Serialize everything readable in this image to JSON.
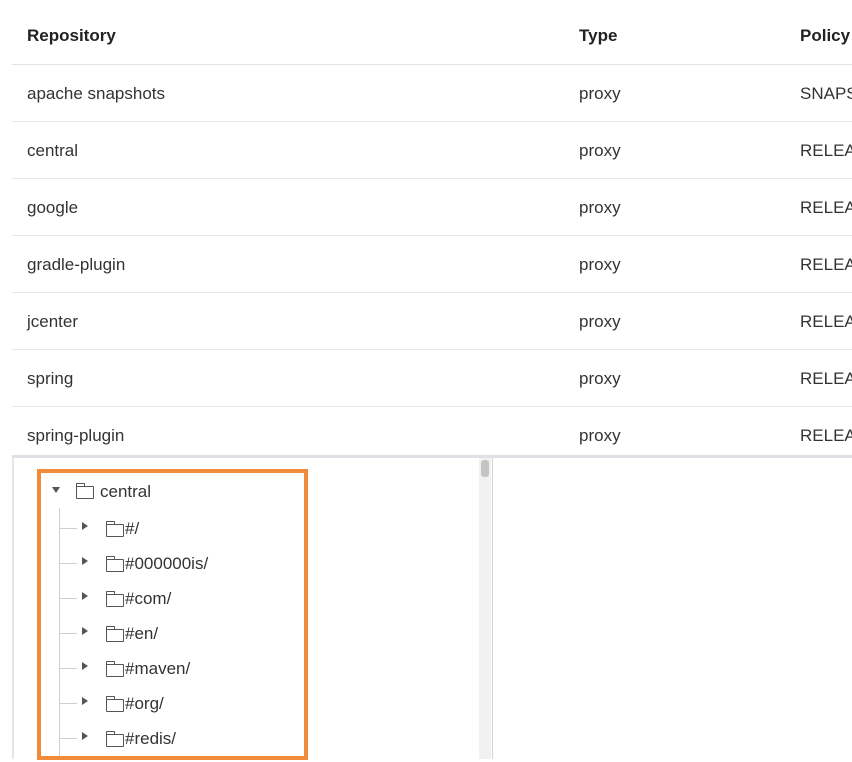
{
  "table": {
    "headers": [
      "Repository",
      "Type",
      "Policy"
    ],
    "rows": [
      [
        "apache snapshots",
        "proxy",
        "SNAPS"
      ],
      [
        "central",
        "proxy",
        "RELEA"
      ],
      [
        "google",
        "proxy",
        "RELEA"
      ],
      [
        "gradle-plugin",
        "proxy",
        "RELEA"
      ],
      [
        "jcenter",
        "proxy",
        "RELEA"
      ],
      [
        "spring",
        "proxy",
        "RELEA"
      ],
      [
        "spring-plugin",
        "proxy",
        "RELEA"
      ]
    ]
  },
  "tree": {
    "root": "central",
    "children": [
      "#/",
      "#000000is/",
      "#com/",
      "#en/",
      "#maven/",
      "#org/",
      "#redis/"
    ]
  },
  "icons": {
    "expanded": "caret-down-icon",
    "collapsed": "caret-right-icon",
    "folder": "folder-icon"
  },
  "colors": {
    "highlight": "#f18a3b"
  }
}
